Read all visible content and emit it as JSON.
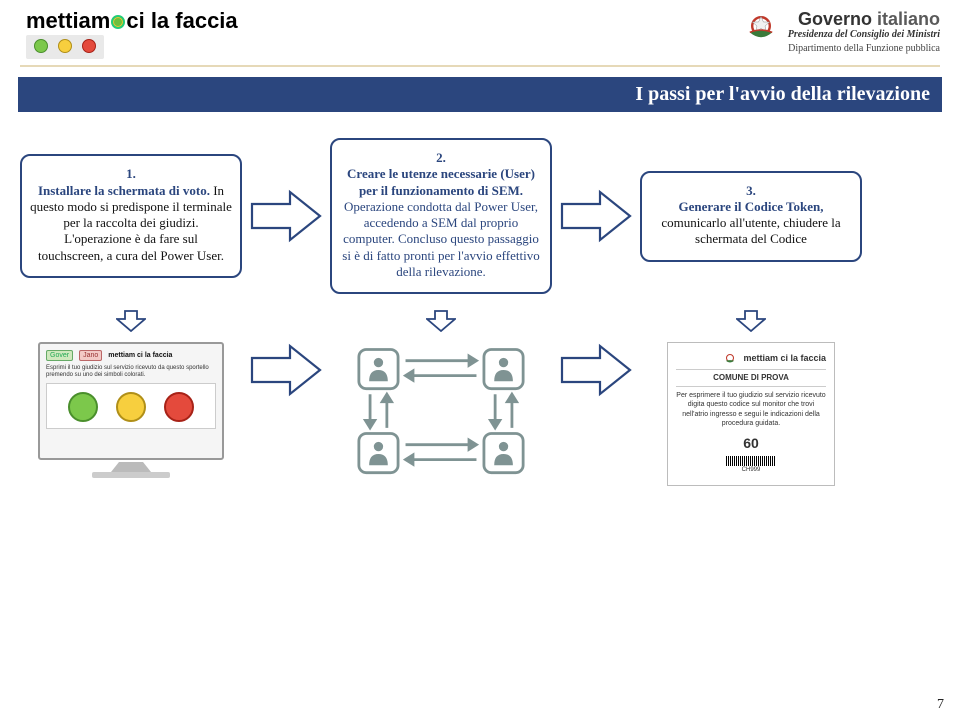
{
  "header": {
    "brand_left": "mettiam   ci la faccia",
    "gov_title_a": "Governo ",
    "gov_title_b": "italiano",
    "gov_sub": "Presidenza del Consiglio dei Ministri",
    "gov_dept": "Dipartimento della Funzione pubblica"
  },
  "title_bar": "I passi per l'avvio della rilevazione",
  "steps": [
    {
      "num": "1.",
      "head": "Installare la schermata di voto.",
      "body": " In questo modo si predispone il terminale per la raccolta dei giudizi. L'operazione è da fare sul touchscreen, a cura del Power User."
    },
    {
      "num": "2.",
      "head": "Creare le utenze necessarie (User) per il funzionamento di SEM.",
      "body": " Operazione condotta dal Power User, accedendo a SEM dal proprio computer. Concluso questo passaggio si è di fatto pronti per l'avvio effettivo della rilevazione."
    },
    {
      "num": "3.",
      "head": "Generare il Codice Token,",
      "body": " comunicarlo all'utente, chiudere la schermata del Codice"
    }
  ],
  "monitor": {
    "tag_g": "Gover",
    "tag_r": "Jano",
    "brand": "mettiam  ci la faccia",
    "line": "Esprimi il tuo giudizio sul servizio ricevuto da questo sportello premendo su uno dei simboli colorati."
  },
  "token": {
    "brand": "mettiam  ci la faccia",
    "comune": "COMUNE DI PROVA",
    "instr": "Per esprimere il tuo giudizio sul servizio ricevuto digita questo codice sul monitor che trovi nell'atrio ingresso e segui le indicazioni della procedura guidata.",
    "code": "60",
    "bar_label": "CH999"
  },
  "page_number": "7"
}
